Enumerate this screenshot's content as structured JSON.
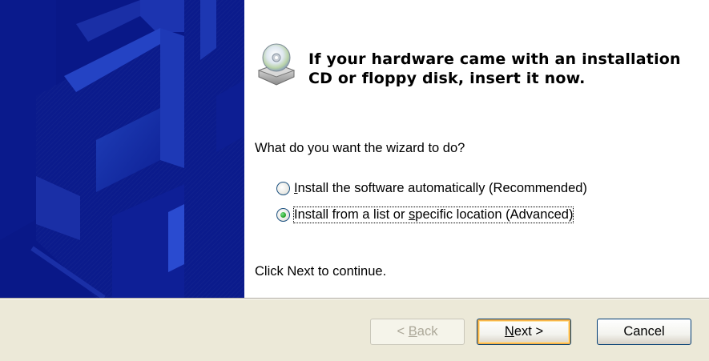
{
  "main": {
    "headline": "If your hardware came with an installation CD or floppy disk, insert it now.",
    "question": "What do you want the wizard to do?",
    "options": [
      {
        "before": "",
        "mnemonic": "I",
        "after": "nstall the software automatically (Recommended)",
        "checked": false
      },
      {
        "before": "Install from a list or ",
        "mnemonic": "s",
        "after": "pecific location (Advanced)",
        "checked": true
      }
    ],
    "hint": "Click Next to continue."
  },
  "footer": {
    "back": {
      "prefix": "< ",
      "mnemonic": "B",
      "rest": "ack"
    },
    "next": {
      "mnemonic": "N",
      "rest": "ext >"
    },
    "cancel": "Cancel"
  },
  "icons": {
    "header_icon": "cd-drive-icon"
  },
  "colors": {
    "side_panel": "#0a1a8a",
    "footer_bg": "#ece9d8",
    "default_button_glow": "#f7b44a",
    "radio_checked": "#21a121"
  }
}
